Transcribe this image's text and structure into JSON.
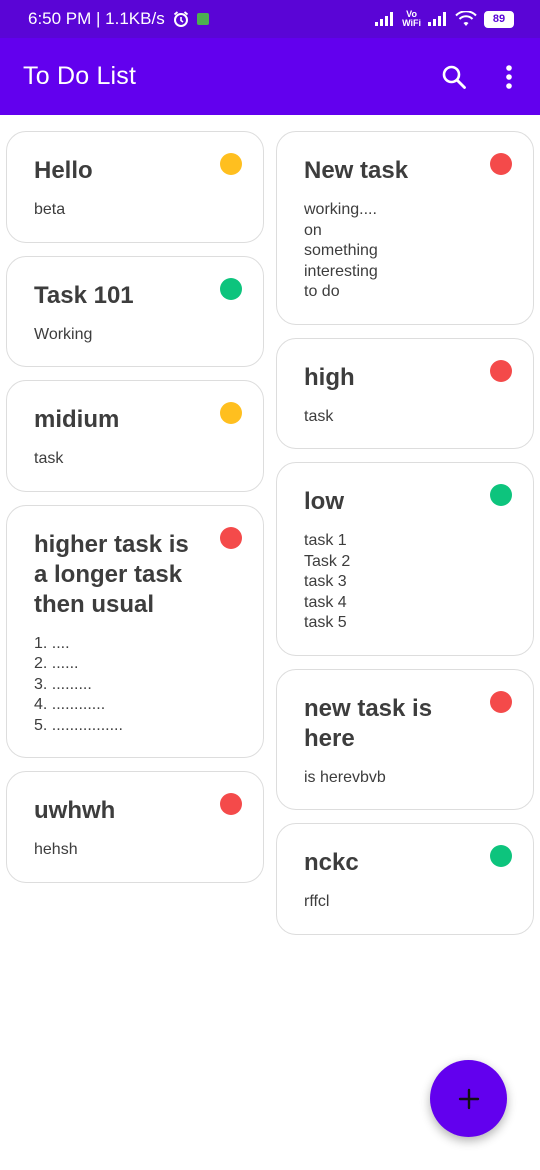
{
  "status_bar": {
    "time_speed": "6:50 PM | 1.1KB/s",
    "vowifi_top": "Vo",
    "vowifi_bottom": "WiFi",
    "battery": "89"
  },
  "app_bar": {
    "title": "To Do List",
    "search_icon": "search-icon",
    "more_icon": "more-vert-icon"
  },
  "colors": {
    "primary": "#6200ee",
    "status_bar": "#5a05d6",
    "priority_high": "#f44a4a",
    "priority_medium": "#ffbf1f",
    "priority_low": "#0dc47d"
  },
  "notes_left": [
    {
      "title": "Hello",
      "body": "beta",
      "priority": "medium",
      "color": "#ffbf1f"
    },
    {
      "title": "Task 101",
      "body": "Working",
      "priority": "low",
      "color": "#0dc47d"
    },
    {
      "title": "midium",
      "body": "task",
      "priority": "medium",
      "color": "#ffbf1f"
    },
    {
      "title": "higher task is a longer task then usual",
      "body": "1. ....\n2. ......\n3. .........\n4. ............\n5. ................",
      "priority": "high",
      "color": "#f44a4a"
    },
    {
      "title": "uwhwh",
      "body": "hehsh",
      "priority": "high",
      "color": "#f44a4a"
    }
  ],
  "notes_right": [
    {
      "title": "New task",
      "body": "working....\non\nsomething\ninteresting\nto do",
      "priority": "high",
      "color": "#f44a4a"
    },
    {
      "title": "high",
      "body": "task",
      "priority": "high",
      "color": "#f44a4a"
    },
    {
      "title": "low",
      "body": "task 1\nTask 2\ntask 3\ntask 4\ntask 5",
      "priority": "low",
      "color": "#0dc47d"
    },
    {
      "title": "new task is here",
      "body": "is herevbvb",
      "priority": "high",
      "color": "#f44a4a"
    },
    {
      "title": "nckc",
      "body": "rffcl",
      "priority": "low",
      "color": "#0dc47d"
    }
  ],
  "fab": {
    "icon": "add-icon"
  }
}
